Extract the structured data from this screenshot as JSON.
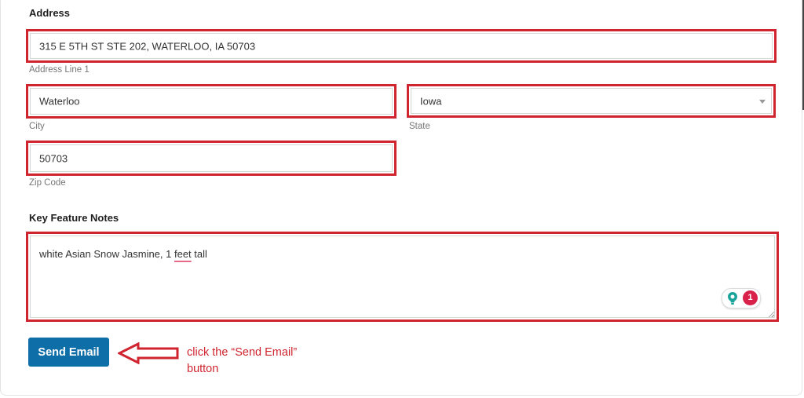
{
  "address": {
    "heading": "Address",
    "address_line_1": {
      "value": "315 E 5TH ST STE 202, WATERLOO, IA 50703",
      "label": "Address Line 1"
    },
    "city": {
      "value": "Waterloo",
      "label": "City"
    },
    "state": {
      "value": "Iowa",
      "label": "State"
    },
    "zip": {
      "value": "50703",
      "label": "Zip Code"
    }
  },
  "notes": {
    "heading": "Key Feature Notes",
    "text_before": "white Asian Snow Jasmine, 1 ",
    "text_flagged": "feet",
    "text_after": " tall",
    "suggestion_count": "1"
  },
  "actions": {
    "send_label": "Send Email"
  },
  "annotation": {
    "instruction": "click the “Send Email” button",
    "highlight_color": "#d0242f"
  },
  "colors": {
    "button": "#0d6ea8",
    "badge": "#d9224a",
    "bulb": "#1aa39a"
  }
}
